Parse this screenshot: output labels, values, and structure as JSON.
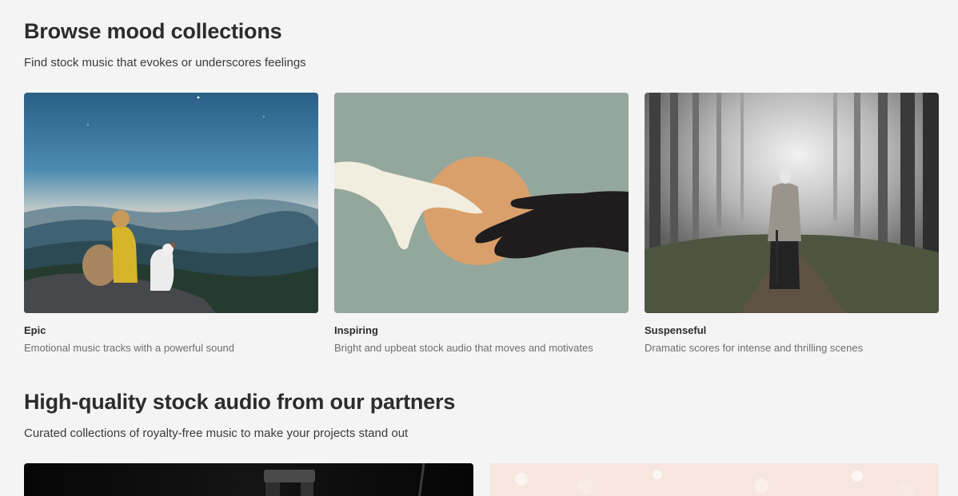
{
  "mood_section": {
    "title": "Browse mood collections",
    "subtitle": "Find stock music that evokes or underscores feelings",
    "cards": [
      {
        "title": "Epic",
        "description": "Emotional music tracks with a powerful sound"
      },
      {
        "title": "Inspiring",
        "description": "Bright and upbeat stock audio that moves and motivates"
      },
      {
        "title": "Suspenseful",
        "description": "Dramatic scores for intense and thrilling scenes"
      }
    ]
  },
  "partners_section": {
    "title": "High-quality stock audio from our partners",
    "subtitle": "Curated collections of royalty-free music to make your projects stand out"
  }
}
